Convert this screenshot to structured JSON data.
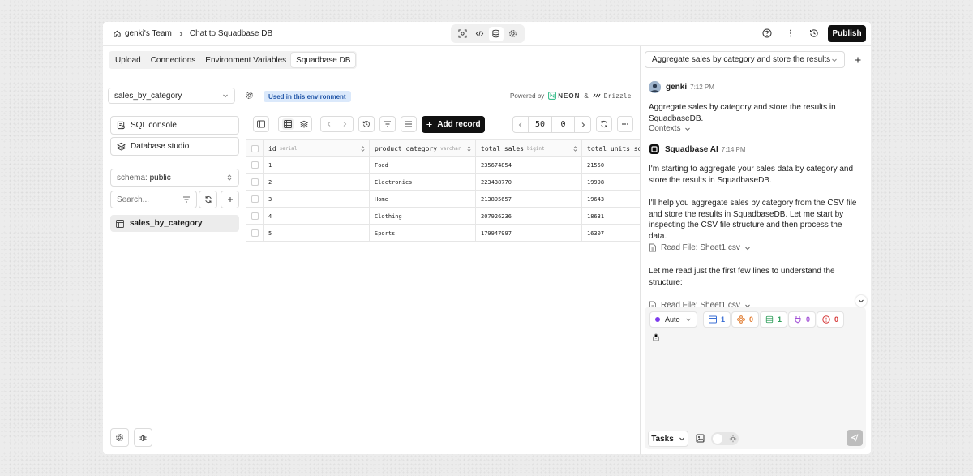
{
  "header": {
    "team": "genki's Team",
    "project": "Chat to Squadbase DB",
    "publish_label": "Publish"
  },
  "tabs": [
    {
      "label": "Upload",
      "active": false
    },
    {
      "label": "Connections",
      "active": false
    },
    {
      "label": "Environment Variables",
      "active": false
    },
    {
      "label": "Squadbase DB",
      "active": true
    }
  ],
  "sidebar": {
    "database_select": "sales_by_category",
    "sql_console_label": "SQL console",
    "database_studio_label": "Database studio",
    "schema_prefix": "schema:",
    "schema_value": "public",
    "search_placeholder": "Search...",
    "tables": [
      "sales_by_category"
    ]
  },
  "env": {
    "badge": "Used in this environment",
    "powered_by": "Powered by",
    "neon": "NEON",
    "amp": "&",
    "drizzle": "Drizzle"
  },
  "toolbar": {
    "add_record_label": "Add record",
    "page_size": "50",
    "offset": "0"
  },
  "table": {
    "columns": [
      {
        "name": "id",
        "type": "serial"
      },
      {
        "name": "product_category",
        "type": "varchar"
      },
      {
        "name": "total_sales",
        "type": "bigint"
      },
      {
        "name": "total_units_sold",
        "type": ""
      }
    ],
    "rows": [
      [
        "1",
        "Food",
        "235674854",
        "21550"
      ],
      [
        "2",
        "Electronics",
        "223438770",
        "19998"
      ],
      [
        "3",
        "Home",
        "213895657",
        "19643"
      ],
      [
        "4",
        "Clothing",
        "207926236",
        "18631"
      ],
      [
        "5",
        "Sports",
        "179947997",
        "16307"
      ]
    ]
  },
  "chat": {
    "task_title": "Aggregate sales by category and store the results",
    "user_name": "genki",
    "user_time": "7:12 PM",
    "user_message": "Aggregate sales by category and store the results in SquadbaseDB.",
    "contexts_label": "Contexts",
    "ai_name": "Squadbase AI",
    "ai_time": "7:14 PM",
    "ai_message_1": "I'm starting to aggregate your sales data by category and store the results in SquadbaseDB.",
    "ai_message_2": "I'll help you aggregate sales by category from the CSV file and store the results in SquadbaseDB. Let me start by inspecting the CSV file structure and then process the data.",
    "read_file_1": "Read File: Sheet1.csv",
    "ai_message_3": "Let me read just the first few lines to understand the structure:",
    "read_file_2": "Read File: Sheet1.csv"
  },
  "composer": {
    "mode": "Auto",
    "chips": [
      {
        "count": "1",
        "color": "#3b6fd4",
        "icon": "window-icon"
      },
      {
        "count": "0",
        "color": "#e07a2e",
        "icon": "component-icon"
      },
      {
        "count": "1",
        "color": "#2f9e5a",
        "icon": "database-icon"
      },
      {
        "count": "0",
        "color": "#a24fd6",
        "icon": "plug-icon"
      },
      {
        "count": "0",
        "color": "#d63a3a",
        "icon": "error-icon"
      }
    ],
    "tasks_label": "Tasks"
  }
}
